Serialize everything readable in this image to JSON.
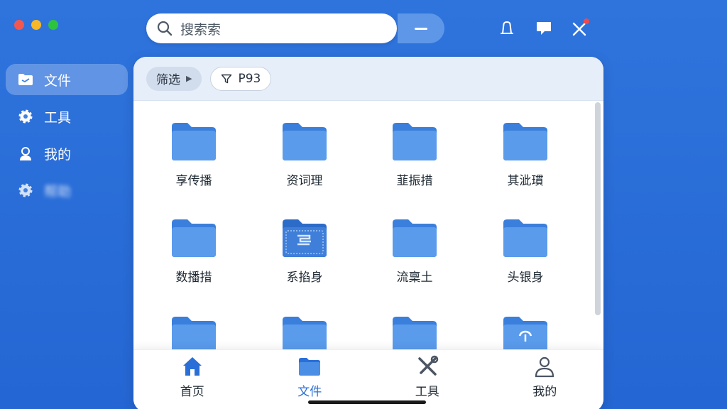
{
  "search": {
    "placeholder": "搜索索"
  },
  "sidebar": {
    "items": [
      {
        "label": "文件",
        "icon": "folder-icon",
        "active": true
      },
      {
        "label": "工具",
        "icon": "gear-icon",
        "active": false
      },
      {
        "label": "我的",
        "icon": "user-icon",
        "active": false
      },
      {
        "label": "帮助",
        "icon": "gear-icon",
        "active": false,
        "blurred": true
      }
    ]
  },
  "filterbar": {
    "filter_label": "筛选",
    "tag_label": "P93"
  },
  "files": [
    {
      "name": "享传播"
    },
    {
      "name": "资词理"
    },
    {
      "name": "韮振措"
    },
    {
      "name": "其泚瑻"
    },
    {
      "name": "数播措"
    },
    {
      "name": "系掐身"
    },
    {
      "name": "流稟土"
    },
    {
      "name": "头银身"
    },
    {
      "name": ""
    },
    {
      "name": ""
    },
    {
      "name": ""
    },
    {
      "name": ""
    }
  ],
  "tabbar": {
    "tabs": [
      {
        "label": "首页",
        "icon": "home-icon"
      },
      {
        "label": "文件",
        "icon": "folder-icon",
        "active": true
      },
      {
        "label": "工具",
        "icon": "tools-icon"
      },
      {
        "label": "我的",
        "icon": "user-icon"
      }
    ]
  },
  "colors": {
    "accent": "#2a6fd8",
    "background": "#2f74dd",
    "folder": "#4a8ee6"
  }
}
